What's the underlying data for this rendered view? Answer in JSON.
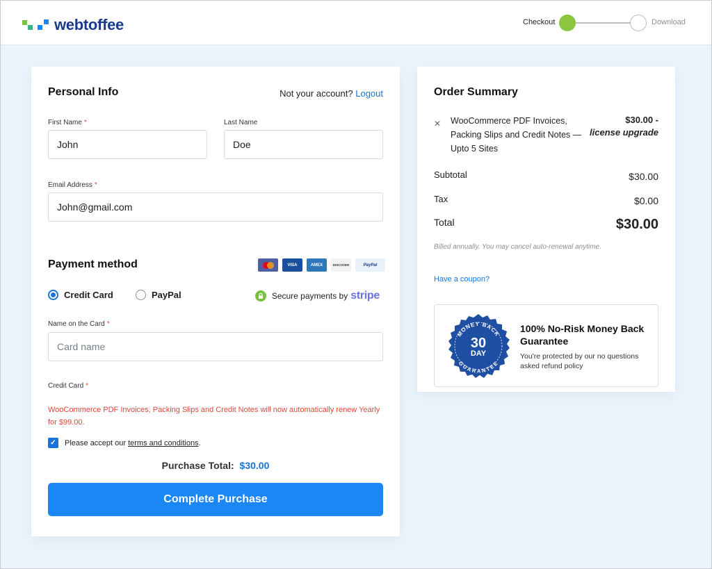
{
  "header": {
    "logo_text": "webtoffee",
    "steps": [
      {
        "label": "Checkout",
        "state": "active"
      },
      {
        "label": "Download",
        "state": "inactive"
      }
    ]
  },
  "personal_info": {
    "title": "Personal Info",
    "account_prompt": "Not your account?",
    "logout_label": "Logout",
    "first_name_label": "First Name",
    "first_name_value": "John",
    "last_name_label": "Last Name",
    "last_name_value": "Doe",
    "email_label": "Email Address",
    "email_value": "John@gmail.com",
    "required_mark": "*"
  },
  "payment": {
    "title": "Payment method",
    "card_logos": [
      "mastercard-icon",
      "visa-icon",
      "amex-icon",
      "discover-icon",
      "paypal-icon"
    ],
    "card_logo_text": {
      "visa": "VISA",
      "amex": "AMEX",
      "discover": "DISCOVER",
      "paypal": "PayPal"
    },
    "options": [
      {
        "label": "Credit Card",
        "selected": true
      },
      {
        "label": "PayPal",
        "selected": false
      }
    ],
    "secure_text": "Secure payments by",
    "stripe_text": "stripe",
    "card_name_label": "Name on the Card",
    "card_name_placeholder": "Card name",
    "credit_card_label": "Credit Card",
    "renew_notice": "WooCommerce PDF Invoices, Packing Slips and Credit Notes will now automatically renew Yearly for $99.00.",
    "terms_prefix": "Please accept our",
    "terms_link": "terms and conditions",
    "terms_suffix": ".",
    "terms_checked": true,
    "purchase_total_label": "Purchase Total:",
    "purchase_total_value": "$30.00",
    "complete_button": "Complete Purchase"
  },
  "order_summary": {
    "title": "Order Summary",
    "item": {
      "remove_icon": "close-icon",
      "name": "WooCommerce PDF Invoices, Packing Slips and Credit Notes — Upto 5 Sites",
      "price": "$30.00 -",
      "price_note": "license upgrade"
    },
    "subtotal_label": "Subtotal",
    "subtotal_value": "$30.00",
    "tax_label": "Tax",
    "tax_value": "$0.00",
    "total_label": "Total",
    "total_value": "$30.00",
    "billed_note": "Billed annually. You may cancel auto-renewal anytime.",
    "coupon_link": "Have a coupon?",
    "guarantee": {
      "badge_top": "MONEY BACK",
      "badge_number": "30",
      "badge_unit": "DAY",
      "badge_bottom": "GUARANTEE",
      "title": "100% No-Risk Money Back Guarantee",
      "subtitle": "You're protected by our no questions asked refund policy"
    }
  },
  "colors": {
    "accent": "#1a87f5",
    "link": "#1a73d9",
    "step_active": "#8cc63f",
    "error": "#e0463a",
    "badge": "#1f4fa3",
    "page_bg": "#eaf4fc"
  }
}
